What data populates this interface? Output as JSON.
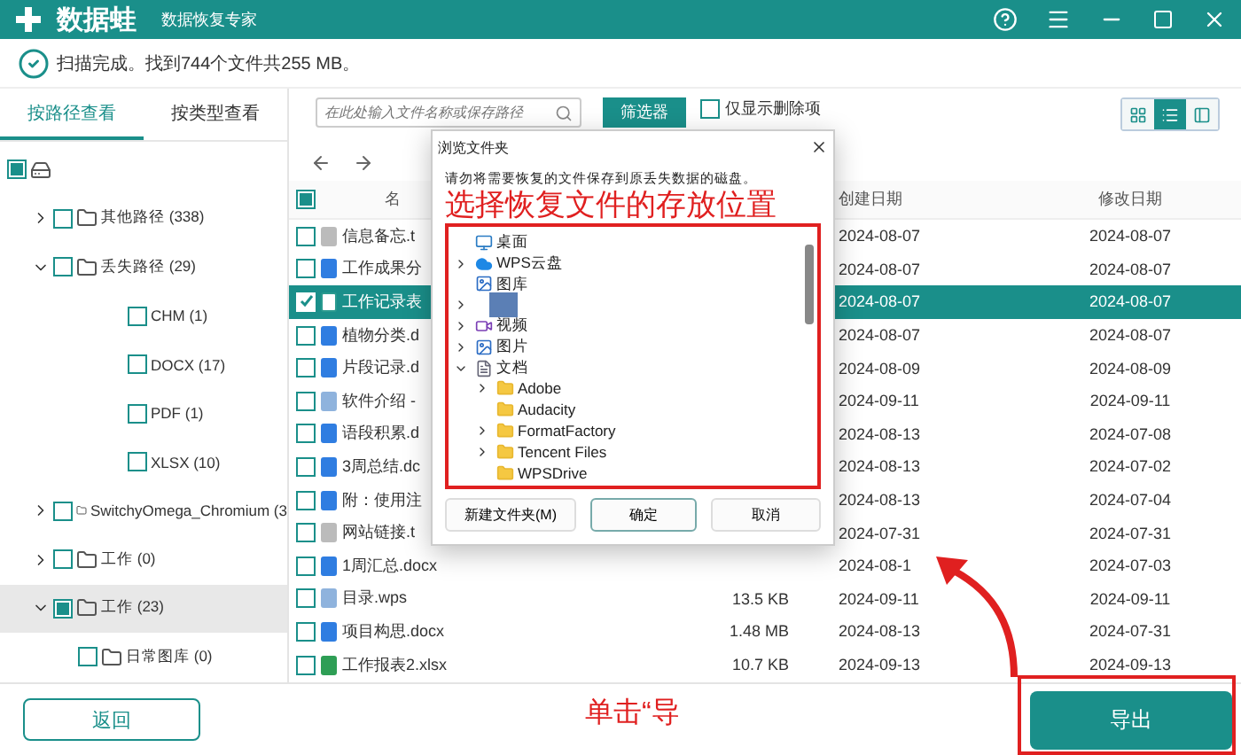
{
  "app": {
    "name": "数据蛙",
    "subtitle": "数据恢复专家"
  },
  "status": "扫描完成。找到744个文件共255 MB。",
  "view_tabs": [
    {
      "label": "按路径查看",
      "selected": true
    },
    {
      "label": "按类型查看",
      "selected": false
    }
  ],
  "tree": [
    {
      "kind": "drive",
      "partial": true,
      "selected": false,
      "children": [
        {
          "kind": "folder",
          "label": "其他路径 (338)",
          "partial": false,
          "expanded": false,
          "selected": false
        },
        {
          "kind": "folder",
          "label": "丢失路径 (29)",
          "partial": false,
          "expanded": true,
          "selected": false,
          "children": [
            {
              "kind": "type",
              "label": "CHM (1)",
              "partial": false,
              "selected": false
            },
            {
              "kind": "type",
              "label": "DOCX (17)",
              "partial": false,
              "selected": false
            },
            {
              "kind": "type",
              "label": "PDF (1)",
              "partial": false,
              "selected": false
            },
            {
              "kind": "type",
              "label": "XLSX (10)",
              "partial": false,
              "selected": false
            }
          ]
        },
        {
          "kind": "folder",
          "label": "SwitchyOmega_Chromium (3",
          "partial": false,
          "expanded": false,
          "selected": false
        },
        {
          "kind": "folder",
          "label": "工作 (0)",
          "partial": false,
          "expanded": false,
          "selected": false
        },
        {
          "kind": "folder",
          "label": "工作 (23)",
          "partial": true,
          "expanded": true,
          "selected": true,
          "children": [
            {
              "kind": "folder",
              "label": "日常图库 (0)",
              "partial": false,
              "selected": false
            }
          ]
        }
      ]
    }
  ],
  "back_button": "返回",
  "search": {
    "placeholder": "在此处输入文件名称或保存路径"
  },
  "filter_button": "筛选器",
  "deleted_only": {
    "label": "仅显示删除项",
    "checked": false
  },
  "view_modes": [
    {
      "kind": "grid",
      "selected": false
    },
    {
      "kind": "list",
      "selected": true
    },
    {
      "kind": "panel",
      "selected": false
    }
  ],
  "table": {
    "header_partial": true,
    "columns": [
      "名",
      "创建日期",
      "修改日期"
    ],
    "rows": [
      {
        "kind": "txt",
        "name": "信息备忘.t",
        "created": "2024-08-07",
        "modified": "2024-08-07",
        "selected": false
      },
      {
        "kind": "doc",
        "name": "工作成果分",
        "created": "2024-08-07",
        "modified": "2024-08-07",
        "selected": false
      },
      {
        "kind": "sheet",
        "name": "工作记录表",
        "created": "2024-08-07",
        "modified": "2024-08-07",
        "selected": true
      },
      {
        "kind": "doc",
        "name": "植物分类.d",
        "created": "2024-08-07",
        "modified": "2024-08-07",
        "selected": false
      },
      {
        "kind": "doc",
        "name": "片段记录.d",
        "created": "2024-08-09",
        "modified": "2024-08-09",
        "selected": false
      },
      {
        "kind": "wps",
        "name": "软件介绍 -",
        "created": "2024-09-11",
        "modified": "2024-09-11",
        "selected": false
      },
      {
        "kind": "doc",
        "name": "语段积累.d",
        "created": "2024-08-13",
        "modified": "2024-07-08",
        "selected": false
      },
      {
        "kind": "doc",
        "name": "3周总结.dc",
        "created": "2024-08-13",
        "modified": "2024-07-02",
        "selected": false
      },
      {
        "kind": "doc",
        "name": "附：使用注",
        "created": "2024-08-13",
        "modified": "2024-07-04",
        "selected": false
      },
      {
        "kind": "txt",
        "name": "网站链接.t",
        "created": "2024-07-31",
        "modified": "2024-07-31",
        "selected": false
      },
      {
        "kind": "doc",
        "name": "1周汇总.docx",
        "created": "2024-08-1",
        "modified": "2024-07-03",
        "selected": false
      },
      {
        "kind": "wps",
        "name": "目录.wps",
        "size": "13.5 KB",
        "created": "2024-09-11",
        "modified": "2024-09-11",
        "selected": false
      },
      {
        "kind": "doc",
        "name": "项目构思.docx",
        "size": "1.48 MB",
        "created": "2024-08-13",
        "modified": "2024-07-31",
        "selected": false
      },
      {
        "kind": "xls",
        "name": "工作报表2.xlsx",
        "size": "10.7 KB",
        "created": "2024-09-13",
        "modified": "2024-09-13",
        "selected": false
      }
    ]
  },
  "dialog": {
    "title": "浏览文件夹",
    "message": "请勿将需要恢复的文件保存到原丢失数据的磁盘。",
    "annotation": "选择恢复文件的存放位置",
    "folders": [
      {
        "kind": "desktop",
        "label": "桌面",
        "expandable": false
      },
      {
        "kind": "cloud",
        "label": "WPS云盘",
        "expandable": true,
        "expanded": false
      },
      {
        "kind": "gallery",
        "label": "图库",
        "expandable": false
      },
      {
        "kind": "redacted",
        "expandable": true,
        "expanded": false
      },
      {
        "kind": "video",
        "label": "视频",
        "expandable": true,
        "expanded": false
      },
      {
        "kind": "pictures",
        "label": "图片",
        "expandable": true,
        "expanded": false
      },
      {
        "kind": "documents",
        "label": "文档",
        "expandable": true,
        "expanded": true,
        "children": [
          {
            "kind": "folder",
            "label": "Adobe",
            "expandable": true,
            "expanded": false
          },
          {
            "kind": "folder",
            "label": "Audacity",
            "expandable": false
          },
          {
            "kind": "folder",
            "label": "FormatFactory",
            "expandable": true,
            "expanded": false
          },
          {
            "kind": "folder",
            "label": "Tencent Files",
            "expandable": true,
            "expanded": false
          },
          {
            "kind": "folder",
            "label": "WPSDrive",
            "expandable": false
          }
        ]
      }
    ],
    "buttons": [
      "新建文件夹(M)",
      "确定",
      "取消"
    ]
  },
  "export_note": "单击“导",
  "export_button": "导出"
}
